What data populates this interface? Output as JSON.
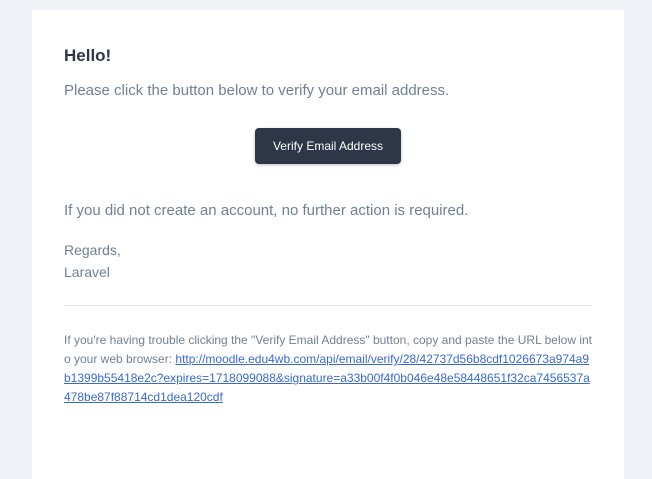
{
  "email": {
    "greeting": "Hello!",
    "intro": "Please click the button below to verify your email address.",
    "button_label": "Verify Email Address",
    "no_action": "If you did not create an account, no further action is required.",
    "regards": "Regards,",
    "sender": "Laravel",
    "subcopy_text": "If you're having trouble clicking the \"Verify Email Address\" button, copy and paste the URL below into your web browser: ",
    "verify_url": "http://moodle.edu4wb.com/api/email/verify/28/42737d56b8cdf1026673a974a9b1399b55418e2c?expires=1718099088&signature=a33b00f4f0b046e48e58448651f32ca7456537a478be87f88714cd1dea120cdf"
  },
  "colors": {
    "page_background": "#eef2f7",
    "card_background": "#ffffff",
    "button_background": "#2d3748",
    "text_muted": "#718096",
    "heading": "#2d3748",
    "link": "#3869d4"
  }
}
